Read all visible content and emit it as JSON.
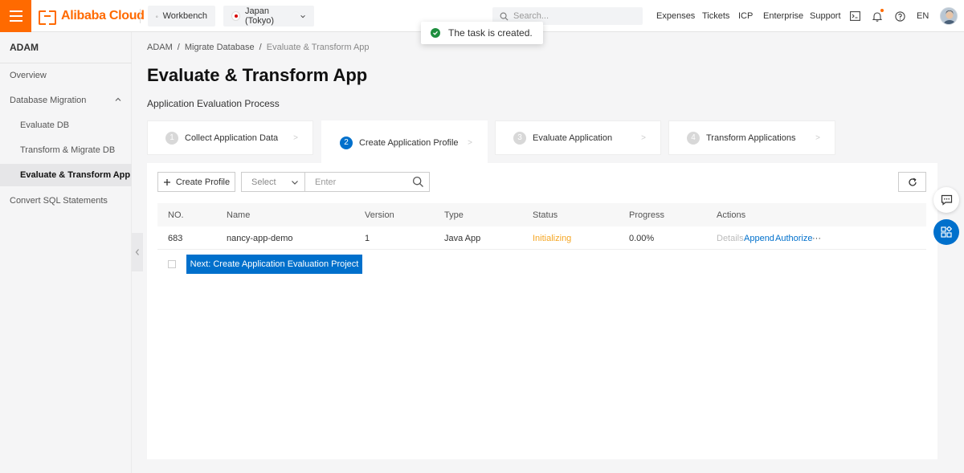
{
  "topbar": {
    "brand": "Alibaba Cloud",
    "workbench": "Workbench",
    "region": "Japan (Tokyo)",
    "search_placeholder": "Search...",
    "nav": [
      "Expenses",
      "Tickets",
      "ICP",
      "Enterprise",
      "Support"
    ],
    "language": "EN"
  },
  "toast": {
    "message": "The task is created.",
    "color": "#1e8e3e"
  },
  "sidebar": {
    "title": "ADAM",
    "items": [
      {
        "label": "Overview"
      },
      {
        "label": "Database Migration"
      },
      {
        "label": "Evaluate DB"
      },
      {
        "label": "Transform & Migrate DB"
      },
      {
        "label": "Evaluate & Transform App"
      },
      {
        "label": "Convert SQL Statements"
      }
    ]
  },
  "breadcrumb": [
    "ADAM",
    "Migrate Database",
    "Evaluate & Transform App"
  ],
  "page": {
    "title": "Evaluate & Transform App",
    "subtitle": "Application Evaluation Process"
  },
  "steps": [
    {
      "num": "1",
      "label": "Collect Application Data"
    },
    {
      "num": "2",
      "label": "Create Application Profile"
    },
    {
      "num": "3",
      "label": "Evaluate Application"
    },
    {
      "num": "4",
      "label": "Transform Applications"
    }
  ],
  "toolbar": {
    "create_label": "Create Profile",
    "select_placeholder": "Select",
    "input_placeholder": "Enter"
  },
  "table": {
    "headers": [
      "NO.",
      "Name",
      "Version",
      "Type",
      "Status",
      "Progress",
      "Actions"
    ],
    "rows": [
      {
        "no": "683",
        "name": "nancy-app-demo",
        "version": "1",
        "type": "Java App",
        "status": "Initializing",
        "progress": "0.00%",
        "actions": [
          "Details",
          "Append",
          "Authorize",
          "···"
        ]
      }
    ]
  },
  "next_button": "Next: Create Application Evaluation Project",
  "colors": {
    "brand": "#ff6a00",
    "primary": "#0070cc",
    "warning": "#f5a623"
  }
}
